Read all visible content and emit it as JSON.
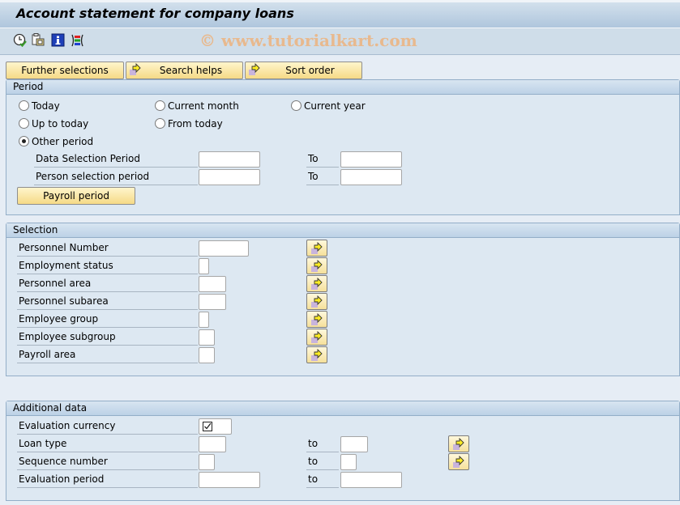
{
  "window": {
    "title": "Account statement for company loans",
    "watermark": "© www.tutorialkart.com"
  },
  "toolbar": {
    "icons": [
      {
        "name": "execute-clock-icon",
        "tooltip": ""
      },
      {
        "name": "get-variant-icon",
        "tooltip": ""
      },
      {
        "name": "info-icon",
        "tooltip": ""
      },
      {
        "name": "selection-options-icon",
        "tooltip": ""
      }
    ]
  },
  "top_buttons": {
    "further_selections": "Further selections",
    "search_helps": "Search helps",
    "sort_order": "Sort order"
  },
  "period": {
    "title": "Period",
    "radios": {
      "today": {
        "label": "Today",
        "selected": false
      },
      "current_month": {
        "label": "Current month",
        "selected": false
      },
      "current_year": {
        "label": "Current year",
        "selected": false
      },
      "up_to_today": {
        "label": "Up to today",
        "selected": false
      },
      "from_today": {
        "label": "From today",
        "selected": false
      },
      "other_period": {
        "label": "Other period",
        "selected": true
      }
    },
    "data_selection": {
      "label": "Data Selection Period",
      "from": "",
      "to_label": "To",
      "to": ""
    },
    "person_selection": {
      "label": "Person selection period",
      "from": "",
      "to_label": "To",
      "to": ""
    },
    "payroll_period_button": "Payroll period"
  },
  "selection": {
    "title": "Selection",
    "rows": [
      {
        "label": "Personnel Number",
        "value": ""
      },
      {
        "label": "Employment status",
        "value": ""
      },
      {
        "label": "Personnel area",
        "value": ""
      },
      {
        "label": "Personnel subarea",
        "value": ""
      },
      {
        "label": "Employee group",
        "value": ""
      },
      {
        "label": "Employee subgroup",
        "value": ""
      },
      {
        "label": "Payroll area",
        "value": ""
      }
    ]
  },
  "additional": {
    "title": "Additional data",
    "evaluation_currency": {
      "label": "Evaluation currency",
      "checked": true
    },
    "loan_type": {
      "label": "Loan type",
      "from": "",
      "to_label": "to",
      "to": ""
    },
    "sequence_number": {
      "label": "Sequence number",
      "from": "",
      "to_label": "to",
      "to": ""
    },
    "evaluation_period": {
      "label": "Evaluation period",
      "from": "",
      "to_label": "to",
      "to": ""
    }
  },
  "colors": {
    "button_yellow": "#f5da86",
    "group_bg": "#dde8f2",
    "header_bg": "#bcd1e6",
    "watermark": "#e8b98e"
  }
}
